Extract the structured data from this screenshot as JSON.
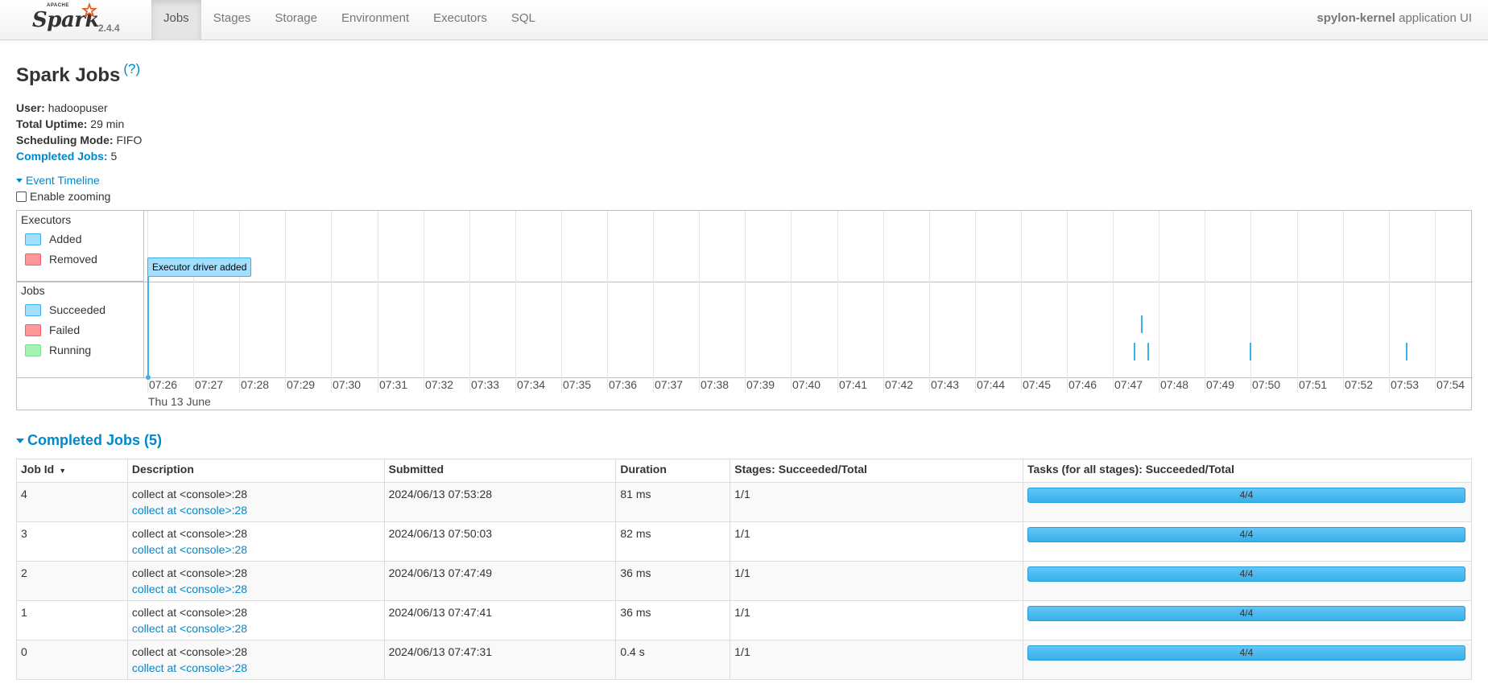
{
  "nav": {
    "brand": "Spark",
    "apache": "APACHE",
    "version": "2.4.4",
    "tabs": [
      "Jobs",
      "Stages",
      "Storage",
      "Environment",
      "Executors",
      "SQL"
    ],
    "app_name": "spylon-kernel",
    "app_suffix": " application UI"
  },
  "page": {
    "title": "Spark Jobs",
    "help": "(?)",
    "user_label": "User:",
    "user": "hadoopuser",
    "uptime_label": "Total Uptime:",
    "uptime": "29 min",
    "mode_label": "Scheduling Mode:",
    "mode": "FIFO",
    "completed_label": "Completed Jobs:",
    "completed": "5",
    "event_timeline": "Event Timeline",
    "enable_zooming": "Enable zooming"
  },
  "timeline": {
    "executors_title": "Executors",
    "executors_legend": [
      "Added",
      "Removed"
    ],
    "jobs_title": "Jobs",
    "jobs_legend": [
      "Succeeded",
      "Failed",
      "Running"
    ],
    "executor_item": "Executor driver added",
    "ticks": [
      "07:26",
      "07:27",
      "07:28",
      "07:29",
      "07:30",
      "07:31",
      "07:32",
      "07:33",
      "07:34",
      "07:35",
      "07:36",
      "07:37",
      "07:38",
      "07:39",
      "07:40",
      "07:41",
      "07:42",
      "07:43",
      "07:44",
      "07:45",
      "07:46",
      "07:47",
      "07:48",
      "07:49",
      "07:50",
      "07:51",
      "07:52",
      "07:53",
      "07:54"
    ],
    "date": "Thu 13 June",
    "colors": {
      "added": "#a3e0ff",
      "removed": "#ff9999",
      "running": "#a4f5b5",
      "succeeded": "#a3e0ff",
      "failed": "#ff9999"
    }
  },
  "completed_jobs": {
    "title": "Completed Jobs (5)",
    "headers": [
      "Job Id",
      "Description",
      "Submitted",
      "Duration",
      "Stages: Succeeded/Total",
      "Tasks (for all stages): Succeeded/Total"
    ],
    "sort_arrow": "▼",
    "rows": [
      {
        "id": "4",
        "desc": "collect at <console>:28",
        "link": "collect at <console>:28",
        "submitted": "2024/06/13 07:53:28",
        "duration": "81 ms",
        "stages": "1/1",
        "tasks": "4/4"
      },
      {
        "id": "3",
        "desc": "collect at <console>:28",
        "link": "collect at <console>:28",
        "submitted": "2024/06/13 07:50:03",
        "duration": "82 ms",
        "stages": "1/1",
        "tasks": "4/4"
      },
      {
        "id": "2",
        "desc": "collect at <console>:28",
        "link": "collect at <console>:28",
        "submitted": "2024/06/13 07:47:49",
        "duration": "36 ms",
        "stages": "1/1",
        "tasks": "4/4"
      },
      {
        "id": "1",
        "desc": "collect at <console>:28",
        "link": "collect at <console>:28",
        "submitted": "2024/06/13 07:47:41",
        "duration": "36 ms",
        "stages": "1/1",
        "tasks": "4/4"
      },
      {
        "id": "0",
        "desc": "collect at <console>:28",
        "link": "collect at <console>:28",
        "submitted": "2024/06/13 07:47:31",
        "duration": "0.4 s",
        "stages": "1/1",
        "tasks": "4/4"
      }
    ]
  }
}
